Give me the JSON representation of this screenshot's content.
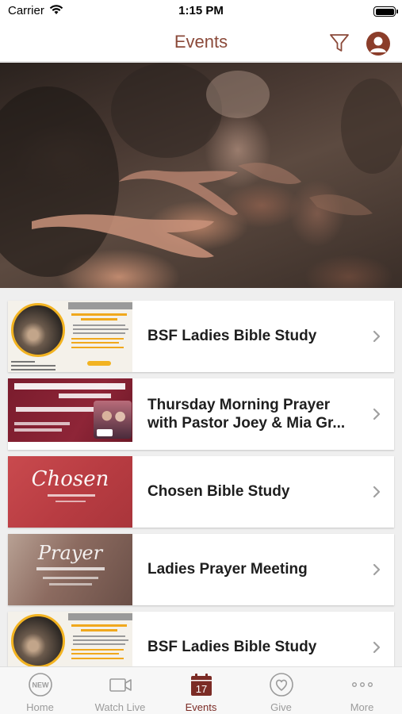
{
  "status_bar": {
    "carrier": "Carrier",
    "time": "1:15 PM",
    "icons": [
      "wifi-icon",
      "battery-icon"
    ]
  },
  "header": {
    "title": "Events",
    "filter_icon": "filter-icon",
    "profile_icon": "user-profile-icon"
  },
  "hero": {
    "image": "audience-clapping-photo"
  },
  "events": [
    {
      "title": "BSF Ladies Bible Study",
      "thumbnail": "bsf-thumbnail"
    },
    {
      "title": "Thursday Morning Prayer with Pastor Joey & Mia Gr...",
      "thumbnail": "thursday-prayer-thumbnail"
    },
    {
      "title": "Chosen Bible Study",
      "thumbnail": "chosen-thumbnail"
    },
    {
      "title": "Ladies Prayer Meeting",
      "thumbnail": "prayer-thumbnail"
    },
    {
      "title": "BSF Ladies Bible Study",
      "thumbnail": "bsf-thumbnail"
    }
  ],
  "thumbnail_text": {
    "chosen_word": "Chosen",
    "prayer_word": "Prayer"
  },
  "tabs": [
    {
      "label": "Home",
      "icon": "new-badge-icon"
    },
    {
      "label": "Watch Live",
      "icon": "video-camera-icon"
    },
    {
      "label": "Events",
      "icon": "calendar-icon",
      "active": true,
      "calendar_day": "17"
    },
    {
      "label": "Give",
      "icon": "heart-circle-icon"
    },
    {
      "label": "More",
      "icon": "ellipsis-icon"
    }
  ],
  "colors": {
    "accent": "#8b4a3a",
    "active_tab": "#7b2b25",
    "inactive_tab": "#9b9b9b"
  }
}
